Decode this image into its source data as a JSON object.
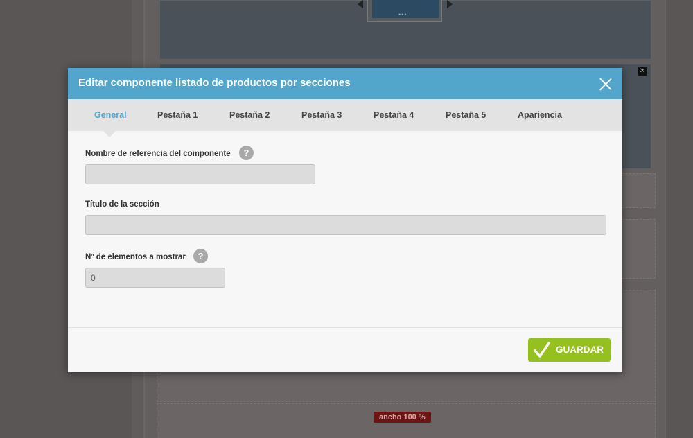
{
  "background": {
    "badge_text": "ancho 100 %",
    "thumb_dots": "•••",
    "mini_close": "✕"
  },
  "modal": {
    "title": "Editar componente listado de productos por secciones",
    "tabs": [
      {
        "label": "General",
        "active": true
      },
      {
        "label": "Pestaña 1"
      },
      {
        "label": "Pestaña 2"
      },
      {
        "label": "Pestaña 3"
      },
      {
        "label": "Pestaña 4"
      },
      {
        "label": "Pestaña 5"
      },
      {
        "label": "Apariencia"
      }
    ],
    "fields": {
      "reference_name": {
        "label": "Nombre de referencia del componente",
        "value": "",
        "help": "?"
      },
      "section_title": {
        "label": "Título de la sección",
        "value": ""
      },
      "items_to_show": {
        "label": "Nº de elementos a mostrar",
        "value": "0",
        "help": "?"
      }
    },
    "save_label": "GUARDAR"
  },
  "colors": {
    "header": "#52a6cc",
    "active_tab": "#52a6cc",
    "save_button": "#95c11f",
    "overlay": "#5c5858"
  },
  "icons": {
    "close": "close-icon",
    "help": "help-icon",
    "save": "checkmark-icon"
  }
}
